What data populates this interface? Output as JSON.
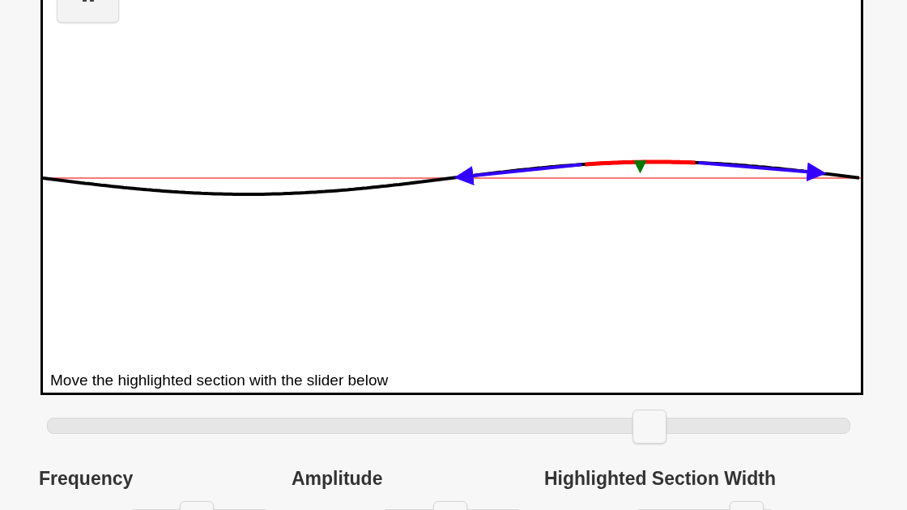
{
  "canvas": {
    "caption": "Move the highlighted section with the slider below"
  },
  "position_slider": {
    "level": 0.75
  },
  "parameters": [
    {
      "label": "Frequency",
      "level": 0.48
    },
    {
      "label": "Amplitude",
      "level": 0.49
    },
    {
      "label": "Highlighted Section Width",
      "level": 0.8
    }
  ]
}
